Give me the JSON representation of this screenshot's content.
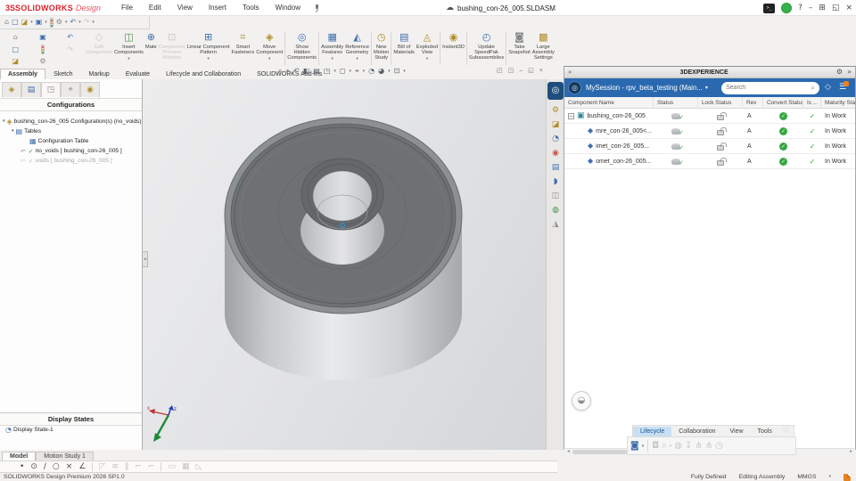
{
  "icons": {
    "caret": "▾",
    "check": "✓",
    "collapse": "−",
    "tree_arrow": "▾",
    "cloud": "☁",
    "help": "?",
    "minimize": "–",
    "tile": "⊞",
    "restore": "◱",
    "close": "×",
    "pin_chevrons": "»",
    "gear": "⚙",
    "search": "⌕",
    "tag": "◇",
    "menu": "☰",
    "heart": "♡",
    "left_arrow": "◂",
    "right_arrow": "▸",
    "terminal": "&gt;_",
    "home": "⌂",
    "new": "□",
    "open": "◪",
    "save": "▣",
    "settings": "⚙",
    "undo": "↶",
    "redo": "↷",
    "compass": "◎",
    "chat": "◒"
  },
  "titlebar": {
    "logo_mark": "3S",
    "brand": "SOLIDWORKS",
    "brand2": "Design",
    "menus": [
      "File",
      "Edit",
      "View",
      "Insert",
      "Tools",
      "Window"
    ],
    "doc": "bushing_con-26_005.SLDASM"
  },
  "cmd": [
    {
      "label": "Edit\nComponent",
      "glyph": "◇"
    },
    {
      "label": "Insert\nComponents",
      "glyph": "◫"
    },
    {
      "label": "Mate",
      "glyph": "⊕"
    },
    {
      "label": "Component\nPreview\nWindow",
      "glyph": "⊡"
    },
    {
      "label": "Linear Component\nPattern",
      "glyph": "⊞"
    },
    {
      "label": "Smart\nFasteners",
      "glyph": "⌗"
    },
    {
      "label": "Move\nComponent",
      "glyph": "◈"
    },
    {
      "label": "Show\nHidden\nComponents",
      "glyph": "◎"
    },
    {
      "label": "Assembly\nFeatures",
      "glyph": "▦"
    },
    {
      "label": "Reference\nGeometry",
      "glyph": "◭"
    },
    {
      "label": "New\nMotion\nStudy",
      "glyph": "◷"
    },
    {
      "label": "Bill of\nMaterials",
      "glyph": "▤"
    },
    {
      "label": "Exploded\nView",
      "glyph": "◬"
    },
    {
      "label": "Instant3D",
      "glyph": "◉"
    },
    {
      "label": "Update\nSpeedPak\nSubassemblies",
      "glyph": "◴"
    },
    {
      "label": "Take\nSnapshot",
      "glyph": "◙"
    },
    {
      "label": "Large\nAssembly\nSettings",
      "glyph": "▩"
    }
  ],
  "ribbon_tabs": [
    "Assembly",
    "Sketch",
    "Markup",
    "Evaluate",
    "Lifecycle and Collaboration",
    "SOLIDWORKS Add-Ins"
  ],
  "headsup": [
    "⌕",
    "⌖",
    "↶",
    "◧",
    "▤",
    "◳",
    "◻",
    "⌖",
    "◔",
    "◕",
    "⊡"
  ],
  "left_tabs": [
    "◈",
    "▤",
    "◳",
    "⌖",
    "◉"
  ],
  "tree": {
    "header": "Configurations",
    "root": "bushing_con-26_005 Configuration(s)  (no_voids)",
    "tables": "Tables",
    "config_table": "Configuration Table",
    "no_voids": "no_voids [ bushing_con-26_005 ]",
    "voids": "voids [ bushing_con-26_005 ]",
    "display_states_header": "Display States",
    "display_state": "Display State-1"
  },
  "taskpane": [
    "⚙",
    "◪",
    "◔",
    "◉",
    "▤",
    "◗",
    "◫",
    "◍",
    "◮"
  ],
  "panel": {
    "title": "3DEXPERIENCE",
    "session": "MySession - rpv_beta_testing (Main...",
    "search_placeholder": "Search",
    "columns": [
      "Component Name",
      "Status",
      "Lock Status",
      "Rev",
      "Convert Status",
      "Is ...",
      "Maturity Stat"
    ],
    "rows": [
      {
        "name": "bushing_con-26_005",
        "rev": "A",
        "maturity": "In Work"
      },
      {
        "name": "mre_con-26_005<...",
        "rev": "A",
        "maturity": "In Work"
      },
      {
        "name": "imet_con-26_005...",
        "rev": "A",
        "maturity": "In Work"
      },
      {
        "name": "omet_con-26_005...",
        "rev": "A",
        "maturity": "In Work"
      }
    ],
    "tabs": [
      "Lifecycle",
      "Collaboration",
      "View",
      "Tools"
    ],
    "tools": [
      "◙",
      "◘",
      "⌕",
      "◍",
      "↧",
      "⋔",
      "⋔",
      "◷"
    ]
  },
  "bottom": {
    "model_tab": "Model",
    "motion_tab": "Motion Study 1",
    "sketch_icons": [
      "•",
      "⊙",
      "∕",
      "○",
      "×",
      "∠",
      "◸",
      "≋",
      "∥",
      "⌐",
      "⌐",
      "▭",
      "▦",
      "◺"
    ],
    "status_left": "SOLIDWORKS Design Premium 2026 SP1.0",
    "status_items": [
      "Fully Defined",
      "Editing Assembly",
      "MMGS"
    ]
  },
  "viewport": {
    "triad_x": "x",
    "triad_z": "z"
  }
}
